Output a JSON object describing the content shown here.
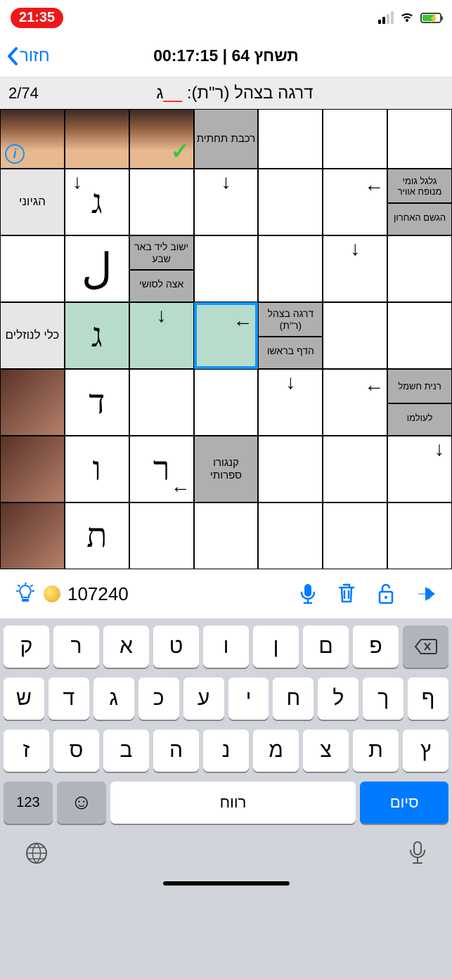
{
  "status": {
    "time": "21:35"
  },
  "nav": {
    "back": "חזור",
    "title": "תשחץ 64 | 00:17:15"
  },
  "clue_bar": {
    "text": "דרגה בצהל (ר\"ת): ",
    "blank": "__",
    "suffix": "ג",
    "progress": "2/74"
  },
  "tools": {
    "coins": "107240"
  },
  "keyboard": {
    "r1": [
      "ק",
      "ר",
      "א",
      "ט",
      "ו",
      "ן",
      "ם",
      "פ"
    ],
    "r2": [
      "ש",
      "ד",
      "ג",
      "כ",
      "ע",
      "י",
      "ח",
      "ל",
      "ך",
      "ף"
    ],
    "r3": [
      "ז",
      "ס",
      "ב",
      "ה",
      "נ",
      "מ",
      "צ",
      "ת",
      "ץ"
    ],
    "num": "123",
    "space": "רווח",
    "done": "סיום"
  },
  "cells": {
    "rakevet": "רכבת תחתית",
    "hegyoni": "הגיוני",
    "galgal": "גלגל גומי מנופח אוויר",
    "hagashem": "הגשם האחרון",
    "yishuv": "ישוב ליד באר שבע",
    "atza": "אצה לסושי",
    "kli": "כלי לנוזלים",
    "darga": "דרגה בצהל (ר\"ת)",
    "hadaf": "הדף בראשו",
    "ranit": "רנית חשמל",
    "leolamo": "לעולמו",
    "kanguru": "קנגורו ספרותי",
    "l1": "ג",
    "l2": "ג",
    "l3": "ד",
    "l4": "ו",
    "l5": "ר",
    "l6": "ת",
    "curve": "ل"
  }
}
